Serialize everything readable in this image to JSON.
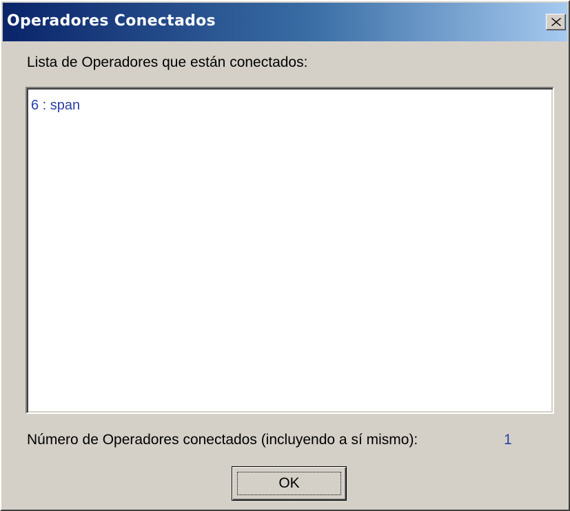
{
  "window": {
    "title": "Operadores Conectados"
  },
  "titlebar": {
    "close_icon": "close-icon"
  },
  "content": {
    "intro_label": "Lista de Operadores que están conectados:",
    "operators": [
      "6 : span"
    ],
    "count_label": "Número de Operadores conectados (incluyendo a sí mismo):",
    "count_value": "1"
  },
  "buttons": {
    "ok_label": "OK"
  },
  "colors": {
    "titlebar_start": "#0a246a",
    "titlebar_end": "#a6caf0",
    "window_bg": "#d4d0c8",
    "list_text": "#2a3ea8"
  }
}
